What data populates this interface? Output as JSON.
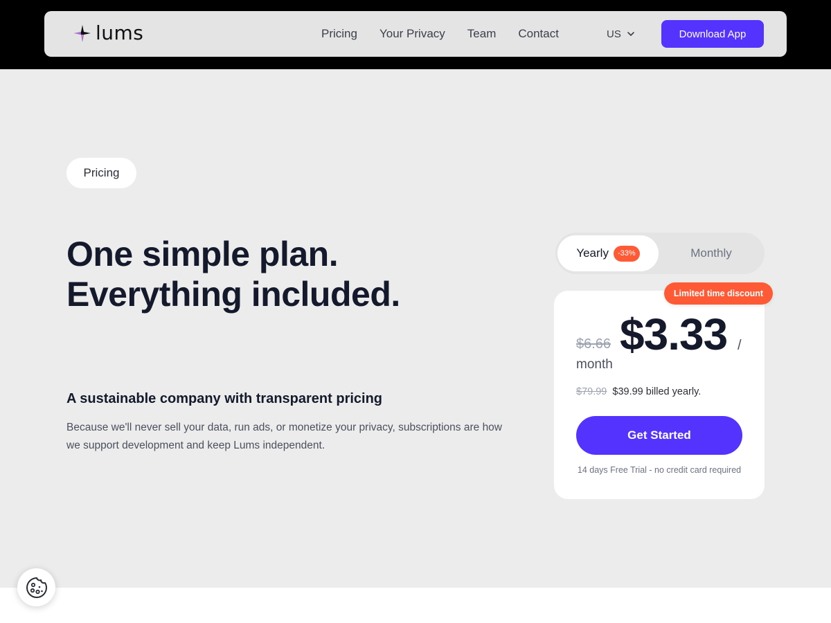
{
  "header": {
    "logo_text": "lums",
    "logo_icon": "sparkle-logo-icon",
    "nav": [
      {
        "label": "Pricing"
      },
      {
        "label": "Your Privacy"
      },
      {
        "label": "Team"
      },
      {
        "label": "Contact"
      }
    ],
    "language": {
      "selected": "US",
      "icon": "chevron-down-icon"
    },
    "download_label": "Download App"
  },
  "hero": {
    "section_pill": "Pricing",
    "headline_line1": "One simple plan.",
    "headline_line2": "Everything included.",
    "subheading": "A sustainable company with transparent pricing",
    "description": "Because we'll never sell your data, run ads, or monetize your privacy, subscriptions are how we support development and keep Lums independent."
  },
  "pricing": {
    "toggle": {
      "yearly_label": "Yearly",
      "yearly_discount": "-33%",
      "monthly_label": "Monthly",
      "selected": "Yearly"
    },
    "limited_badge": "Limited time discount",
    "old_price": "$6.66",
    "price": "$3.33",
    "per_slash": "/",
    "per_month": "month",
    "billed_old": "$79.99",
    "billed_text": "$39.99 billed yearly.",
    "cta_label": "Get Started",
    "trial_note": "14 days Free Trial - no credit card required"
  },
  "cookie": {
    "icon": "cookie-icon"
  },
  "colors": {
    "accent": "#5533ff",
    "discount": "#ff5a36",
    "background": "#ececec",
    "header_band": "#000000"
  }
}
